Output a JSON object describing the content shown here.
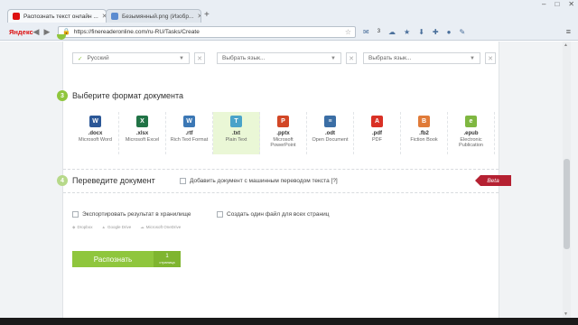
{
  "browser": {
    "tabs": [
      {
        "title": "Распознать текст онлайн ...",
        "active": true
      },
      {
        "title": "Безымянный.png (Изобр...",
        "active": false
      }
    ],
    "new_tab": "+",
    "window_controls": {
      "minimize": "–",
      "maximize": "□",
      "close": "✕"
    },
    "logo": "Яндекс",
    "back": "◀",
    "forward": "▶",
    "url": "https://finereaderonline.com/ru-RU/Tasks/Create",
    "mail_count": "3",
    "menu": "≡"
  },
  "languages": {
    "selected": "Русский",
    "placeholder1": "Выбрать язык...",
    "placeholder2": "Выбрать язык..."
  },
  "step3": {
    "number": "3",
    "title": "Выберите формат документа",
    "formats": [
      {
        "ext": ".docx",
        "name": "Microsoft Word",
        "icon": "word-icon",
        "color": "#2b5797",
        "glyph": "W"
      },
      {
        "ext": ".xlsx",
        "name": "Microsoft Excel",
        "icon": "excel-icon",
        "color": "#217346",
        "glyph": "X"
      },
      {
        "ext": ".rtf",
        "name": "Rich Text Format",
        "icon": "rtf-icon",
        "color": "#3c78b5",
        "glyph": "W"
      },
      {
        "ext": ".txt",
        "name": "Plain Text",
        "icon": "txt-icon",
        "color": "#4aa3c9",
        "glyph": "T"
      },
      {
        "ext": ".pptx",
        "name": "Microsoft PowerPoint",
        "icon": "powerpoint-icon",
        "color": "#d24726",
        "glyph": "P"
      },
      {
        "ext": ".odt",
        "name": "Open Document",
        "icon": "odt-icon",
        "color": "#3b6ea5",
        "glyph": "≡"
      },
      {
        "ext": ".pdf",
        "name": "PDF",
        "icon": "pdf-icon",
        "color": "#d93025",
        "glyph": "A"
      },
      {
        "ext": ".fb2",
        "name": "Fiction Book",
        "icon": "fb2-icon",
        "color": "#e07b39",
        "glyph": "B"
      },
      {
        "ext": ".epub",
        "name": "Electronic Publication",
        "icon": "epub-icon",
        "color": "#7fb741",
        "glyph": "e"
      }
    ],
    "selected_format": ".txt"
  },
  "step4": {
    "number": "4",
    "title": "Переведите документ",
    "translate_label": "Добавить документ с машинным переводом текста [?]",
    "beta": "Beta"
  },
  "options": {
    "export_label": "Экспортировать результат в хранилище",
    "single_file_label": "Создать один файл для всех страниц",
    "storages": [
      "Dropbox",
      "Google Drive",
      "Microsoft OneDrive"
    ]
  },
  "recognize": {
    "label": "Распознать",
    "pages_count": "1",
    "pages_label": "страница"
  },
  "colors": {
    "accent_green": "#8fc63d",
    "beta_red": "#b52132"
  }
}
